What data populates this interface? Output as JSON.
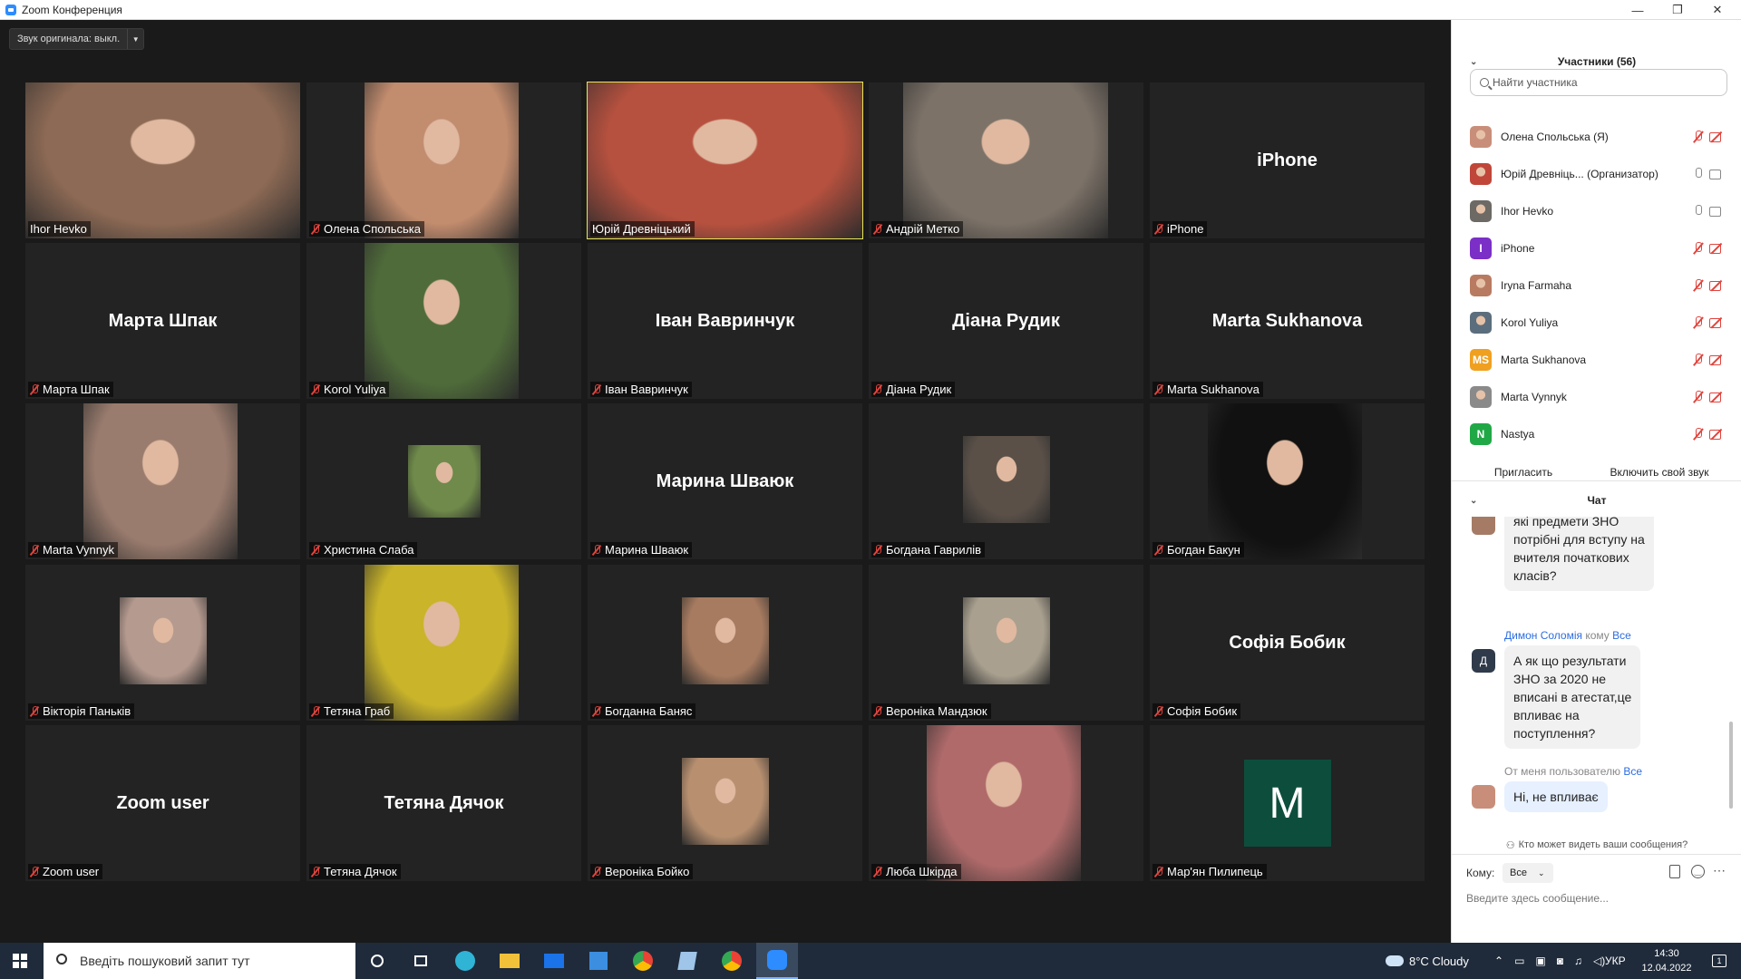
{
  "window": {
    "title": "Zoom Конференция",
    "minimize": "—",
    "maximize": "❐",
    "close": "✕"
  },
  "original_audio": {
    "label": "Звук оригинала: выкл.",
    "dropdown": "▼"
  },
  "tiles": [
    {
      "name": "Ihor Hevko",
      "type": "video",
      "muted": false
    },
    {
      "name": "Олена Спольська",
      "type": "video",
      "muted": true
    },
    {
      "name": "Юрій Древніцький",
      "type": "video",
      "muted": false,
      "active": true
    },
    {
      "name": "Андрій Метко",
      "type": "video",
      "muted": true
    },
    {
      "name": "iPhone",
      "type": "name",
      "display": "iPhone",
      "muted": true
    },
    {
      "name": "Марта Шпак",
      "type": "name",
      "display": "Марта Шпак",
      "muted": true
    },
    {
      "name": "Korol Yuliya",
      "type": "video",
      "muted": true
    },
    {
      "name": "Іван Вавринчук",
      "type": "name",
      "display": "Іван Вавринчук",
      "muted": true
    },
    {
      "name": "Діана Рудик",
      "type": "name",
      "display": "Діана Рудик",
      "muted": true
    },
    {
      "name": "Marta Sukhanova",
      "type": "name",
      "display": "Marta Sukhanova",
      "muted": true
    },
    {
      "name": "Marta Vynnyk",
      "type": "video",
      "muted": true
    },
    {
      "name": "Христина Слаба",
      "type": "photo",
      "muted": true
    },
    {
      "name": "Марина Шваюк",
      "type": "name",
      "display": "Марина Шваюк",
      "muted": true
    },
    {
      "name": "Богдана Гаврилів",
      "type": "photo",
      "muted": true
    },
    {
      "name": "Богдан Бакун",
      "type": "video",
      "muted": true
    },
    {
      "name": "Вікторія Паньків",
      "type": "photo",
      "muted": true
    },
    {
      "name": "Тетяна Граб",
      "type": "video",
      "muted": true
    },
    {
      "name": "Богданна Баняс",
      "type": "photo",
      "muted": true
    },
    {
      "name": "Вероніка Мандзюк",
      "type": "photo",
      "muted": true
    },
    {
      "name": "Софія Бобик",
      "type": "name",
      "display": "Софія Бобик",
      "muted": true
    },
    {
      "name": "Zoom user",
      "type": "name",
      "display": "Zoom user",
      "muted": true
    },
    {
      "name": "Тетяна Дячок",
      "type": "name",
      "display": "Тетяна Дячок",
      "muted": true
    },
    {
      "name": "Вероніка Бойко",
      "type": "photo",
      "muted": true
    },
    {
      "name": "Люба Шкірда",
      "type": "video",
      "muted": true
    },
    {
      "name": "Мар'ян Пилипець",
      "type": "letter",
      "display": "M",
      "muted": true
    }
  ],
  "participants": {
    "title": "Участники (56)",
    "search_placeholder": "Найти участника",
    "list": [
      {
        "name": "Олена Спольська (Я)",
        "avatar": "photo",
        "color": "#c98e7a",
        "mic": "muted",
        "cam": "off"
      },
      {
        "name": "Юрій Древніць...  (Организатор)",
        "avatar": "photo",
        "color": "#c0463a",
        "mic": "on",
        "cam": "on"
      },
      {
        "name": "Ihor Hevko",
        "avatar": "photo",
        "color": "#6d6a66",
        "mic": "on",
        "cam": "on"
      },
      {
        "name": "iPhone",
        "avatar": "I",
        "color": "#7b2fc7",
        "mic": "muted",
        "cam": "off"
      },
      {
        "name": "Iryna Farmaha",
        "avatar": "photo",
        "color": "#b87b62",
        "mic": "muted",
        "cam": "off"
      },
      {
        "name": "Korol Yuliya",
        "avatar": "photo",
        "color": "#5b6e7d",
        "mic": "muted",
        "cam": "off"
      },
      {
        "name": "Marta Sukhanova",
        "avatar": "MS",
        "color": "#f0a020",
        "mic": "muted",
        "cam": "off"
      },
      {
        "name": "Marta Vynnyk",
        "avatar": "photo",
        "color": "#8a8a8a",
        "mic": "muted",
        "cam": "off"
      },
      {
        "name": "Nastya",
        "avatar": "N",
        "color": "#21a846",
        "mic": "muted",
        "cam": "off"
      }
    ],
    "invite": "Пригласить",
    "unmute_self": "Включить свой звук"
  },
  "chat": {
    "title": "Чат",
    "messages": [
      {
        "text_lines": [
          "які предмети ЗНО",
          "потрібні для вступу на",
          "вчителя початкових",
          "класів?"
        ]
      },
      {
        "from": "Димон Соломія",
        "to_word": "кому",
        "to": "Все",
        "avatar": "Д",
        "text_lines": [
          "А як що результати",
          "ЗНО за 2020 не",
          "вписані в атестат,це",
          "впливає на",
          "поступлення?"
        ]
      },
      {
        "from_prefix": "От меня пользователю",
        "to": "Все",
        "text_lines": [
          "Ні, не впливає"
        ]
      }
    ],
    "privacy_note": "Кто может видеть ваши сообщения?",
    "to_label": "Кому:",
    "to_value": "Все",
    "input_placeholder": "Введите здесь сообщение..."
  },
  "taskbar": {
    "search_placeholder": "Введіть пошуковий запит тут",
    "weather": "8°C  Cloudy",
    "lang": "УКР",
    "time": "14:30",
    "date": "12.04.2022",
    "notif_count": "1"
  }
}
